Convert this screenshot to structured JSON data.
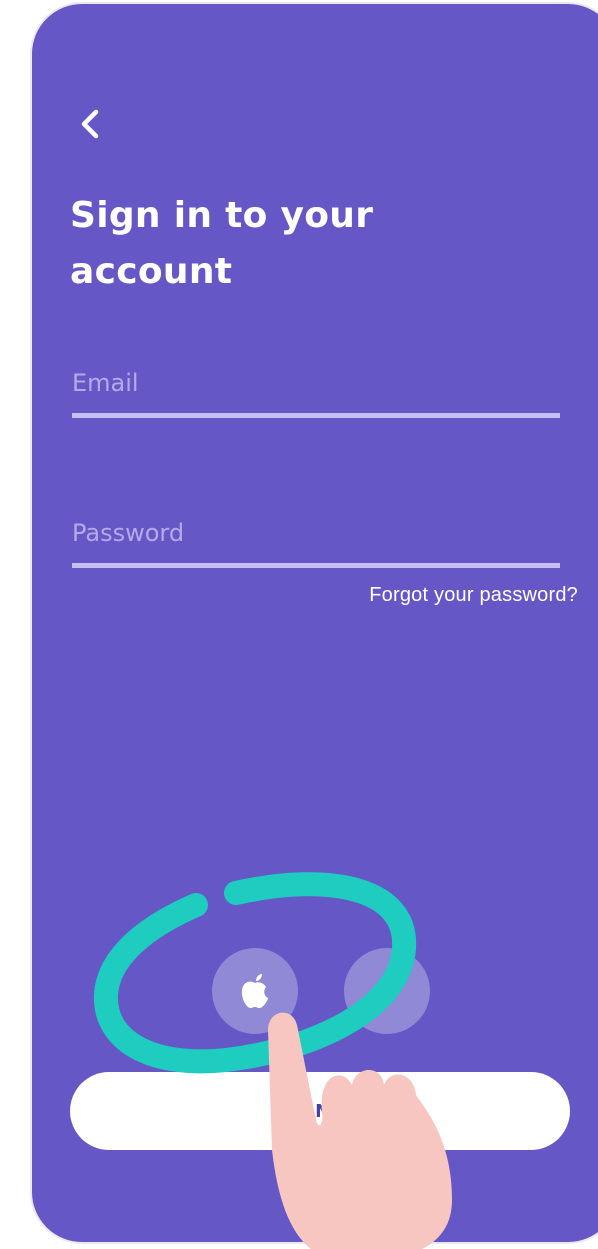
{
  "header": {
    "title": "Sign in to your account"
  },
  "form": {
    "email_placeholder": "Email",
    "password_placeholder": "Password",
    "forgot_label": "Forgot your password?"
  },
  "social": [
    {
      "icon": "apple-icon"
    },
    {
      "icon": "social-login-icon"
    }
  ],
  "primary": {
    "sign_in_label": "SIGN IN"
  },
  "colors": {
    "background": "#6557C6",
    "button": "#FFFFFF",
    "button_text": "#4B3FA6",
    "social_circle": "#9089D6",
    "highlight_ring": "#1ECDBF",
    "hand": "#F7C6C1"
  }
}
